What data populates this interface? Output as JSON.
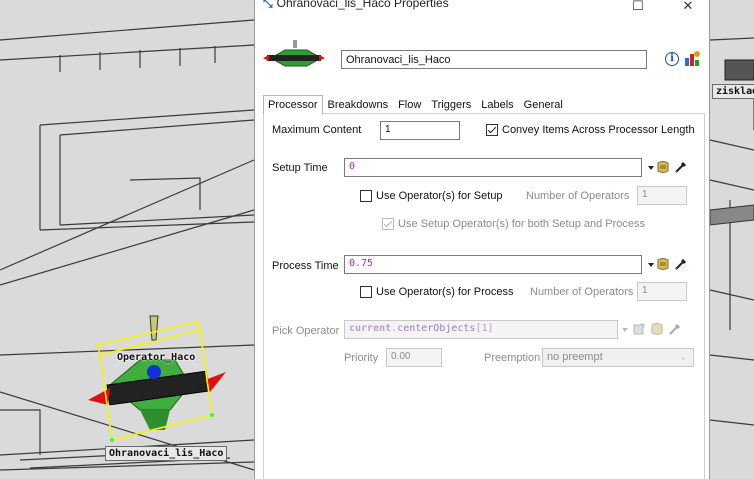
{
  "scene": {
    "labels": {
      "operator": "Operator_Haco",
      "processor": "Ohranovaci_lis_Haco",
      "right_object": "zisklad_"
    }
  },
  "dialog": {
    "title": "Ohranovaci_lis_Haco  Properties",
    "window_buttons": {
      "minimize": "☐",
      "close": "✕"
    },
    "object_name": "Ohranovaci_lis_Haco",
    "info_icon_glyph": "i",
    "tabs": [
      "Processor",
      "Breakdowns",
      "Flow",
      "Triggers",
      "Labels",
      "General"
    ],
    "active_tab": "Processor",
    "processor": {
      "max_content_label": "Maximum Content",
      "max_content_value": "1",
      "convey_label": "Convey Items Across Processor Length",
      "convey_checked": true,
      "setup_time_label": "Setup Time",
      "setup_time_value": "0",
      "use_op_setup_label": "Use Operator(s) for Setup",
      "num_ops_label": "Number of Operators",
      "num_ops_setup_value": "1",
      "use_setup_both_label": "Use Setup Operator(s) for both Setup and Process",
      "use_setup_both_checked": true,
      "process_time_label": "Process Time",
      "process_time_value": "0.75",
      "use_op_process_label": "Use Operator(s) for Process",
      "num_ops_process_value": "1",
      "pick_operator_label": "Pick Operator",
      "pick_operator_code": {
        "obj": "current",
        "dot": ".",
        "method": "centerObjects",
        "idx": "[1]"
      },
      "priority_label": "Priority",
      "priority_value": "0.00",
      "preemption_label": "Preemption",
      "preemption_value": "no preempt"
    }
  },
  "colors": {
    "code_magenta": "#c020c0",
    "selection_yellow": "#f5f500",
    "info_blue": "#1a4fb4"
  }
}
